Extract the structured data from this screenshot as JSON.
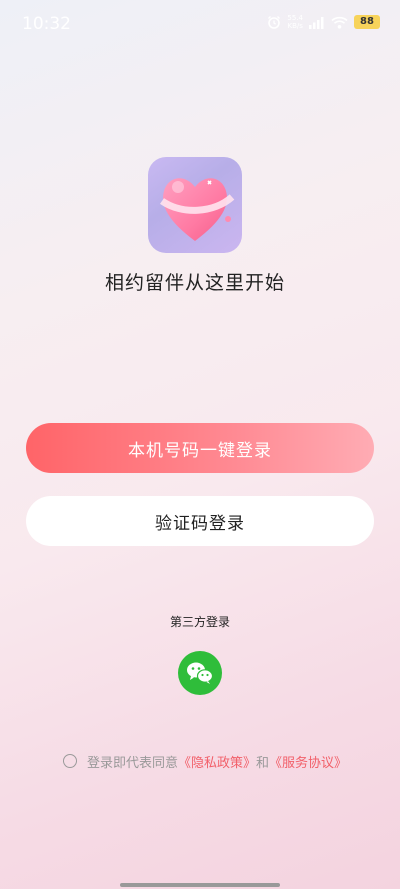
{
  "status_bar": {
    "time": "10:32",
    "net_speed_value": "55.4",
    "net_speed_unit": "KB/s",
    "battery": "88"
  },
  "app": {
    "tagline": "相约留伴从这里开始"
  },
  "buttons": {
    "one_click_login": "本机号码一键登录",
    "code_login": "验证码登录"
  },
  "third_party": {
    "label": "第三方登录"
  },
  "agreement": {
    "prefix": "登录即代表同意",
    "privacy_link": "《隐私政策》",
    "connector": "和",
    "service_link": "《服务协议》"
  },
  "colors": {
    "primary_button": "#ff6b72",
    "link": "#f2606a",
    "wechat": "#2fbd3a"
  }
}
